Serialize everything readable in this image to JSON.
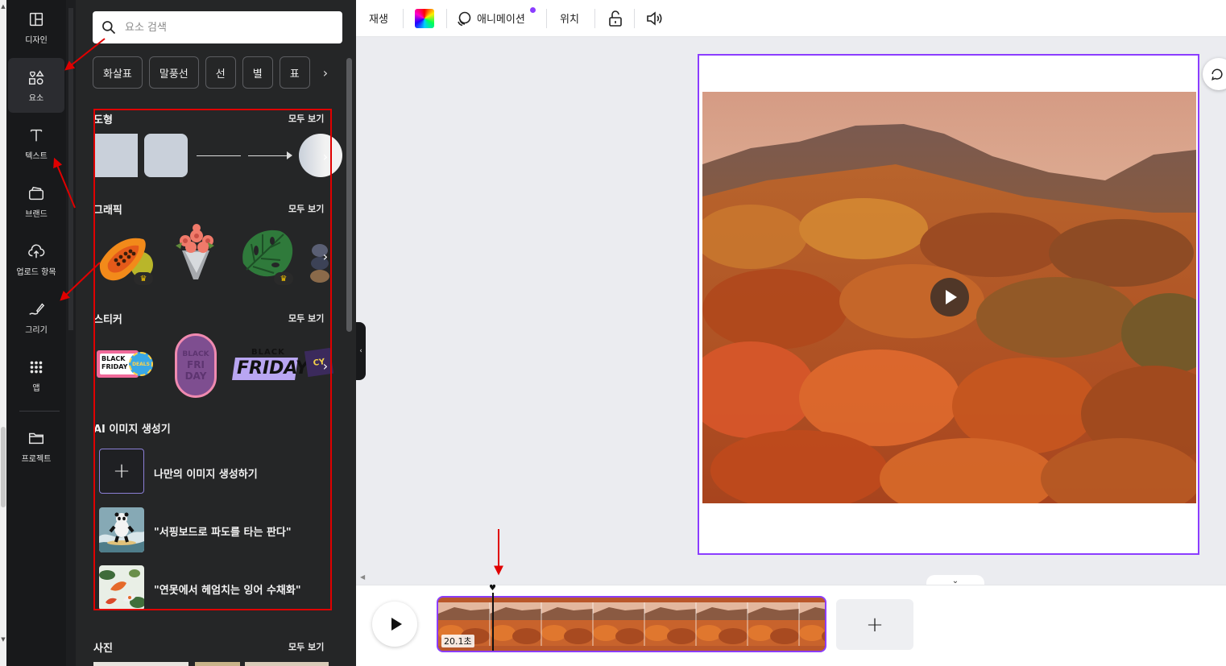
{
  "rail": {
    "items": [
      {
        "label": "디자인"
      },
      {
        "label": "요소"
      },
      {
        "label": "텍스트"
      },
      {
        "label": "브랜드"
      },
      {
        "label": "업로드 항목"
      },
      {
        "label": "그리기"
      },
      {
        "label": "앱"
      },
      {
        "label": "프로젝트"
      }
    ]
  },
  "panel": {
    "search_placeholder": "요소 검색",
    "chips": [
      "화살표",
      "말풍선",
      "선",
      "별",
      "표"
    ],
    "sections": {
      "shapes": {
        "title": "도형",
        "more": "모두 보기"
      },
      "graphics": {
        "title": "그래픽",
        "more": "모두 보기"
      },
      "stickers": {
        "title": "스티커",
        "more": "모두 보기"
      },
      "ai": {
        "title": "AI 이미지 생성기",
        "items": [
          {
            "label": "나만의 이미지 생성하기"
          },
          {
            "label": "\"서핑보드로 파도를 타는 판다\""
          },
          {
            "label": "\"연못에서 헤엄치는 잉어 수채화\""
          }
        ]
      },
      "photos": {
        "title": "사진",
        "more": "모두 보기"
      }
    },
    "sticker_texts": {
      "s1_top": "BLACK",
      "s1_bottom": "FRIDAY",
      "s1_badge": "DEALS",
      "s2_a": "BLACK",
      "s2_b": "FRI",
      "s2_c": "DAY",
      "s3_top": "BLACK",
      "s3_bottom": "FRIDAY",
      "s4": "CY"
    }
  },
  "toolbar": {
    "play": "재생",
    "animation": "애니메이션",
    "position": "위치"
  },
  "timeline": {
    "duration": "20.1초"
  },
  "colors": {
    "accent": "#8b3dff",
    "annotation": "#e00000"
  }
}
